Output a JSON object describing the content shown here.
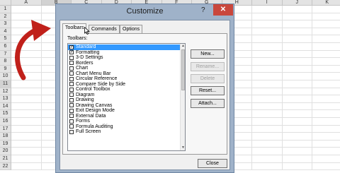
{
  "spreadsheet": {
    "columns": [
      "A",
      "B",
      "C",
      "D",
      "E",
      "F",
      "G",
      "H",
      "I",
      "J",
      "K"
    ],
    "rows": [
      "1",
      "2",
      "3",
      "4",
      "5",
      "6",
      "7",
      "8",
      "9",
      "10",
      "11",
      "12",
      "13",
      "14",
      "15",
      "16",
      "17",
      "18",
      "19",
      "20",
      "21",
      "22"
    ]
  },
  "dialog": {
    "title": "Customize",
    "help_glyph": "?",
    "close_glyph": "✕",
    "tabs": [
      {
        "label": "Toolbars",
        "active": true
      },
      {
        "label": "Commands",
        "active": false
      },
      {
        "label": "Options",
        "active": false
      }
    ],
    "toolbars_label": "Toolbars:",
    "toolbar_items": [
      {
        "label": "Standard",
        "checked": true,
        "selected": true
      },
      {
        "label": "Formatting",
        "checked": true,
        "selected": false
      },
      {
        "label": "3-D Settings",
        "checked": false,
        "selected": false
      },
      {
        "label": "Borders",
        "checked": false,
        "selected": false
      },
      {
        "label": "Chart",
        "checked": false,
        "selected": false
      },
      {
        "label": "Chart Menu Bar",
        "checked": false,
        "selected": false
      },
      {
        "label": "Circular Reference",
        "checked": false,
        "selected": false
      },
      {
        "label": "Compare Side by Side",
        "checked": false,
        "selected": false
      },
      {
        "label": "Control Toolbox",
        "checked": false,
        "selected": false
      },
      {
        "label": "Diagram",
        "checked": false,
        "selected": false
      },
      {
        "label": "Drawing",
        "checked": false,
        "selected": false
      },
      {
        "label": "Drawing Canvas",
        "checked": false,
        "selected": false
      },
      {
        "label": "Exit Design Mode",
        "checked": false,
        "selected": false
      },
      {
        "label": "External Data",
        "checked": false,
        "selected": false
      },
      {
        "label": "Forms",
        "checked": false,
        "selected": false
      },
      {
        "label": "Formula Auditing",
        "checked": false,
        "selected": false
      },
      {
        "label": "Full Screen",
        "checked": false,
        "selected": false
      }
    ],
    "buttons": {
      "new": "New...",
      "rename": "Rename...",
      "delete": "Delete",
      "reset": "Reset...",
      "attach": "Attach...",
      "close": "Close"
    }
  },
  "colors": {
    "selection": "#3399ff",
    "arrow": "#c0201a",
    "dialog_frame": "#9fb2c9"
  },
  "icons": {
    "arrow": "curved-arrow-icon",
    "cursor": "mouse-pointer-icon"
  }
}
